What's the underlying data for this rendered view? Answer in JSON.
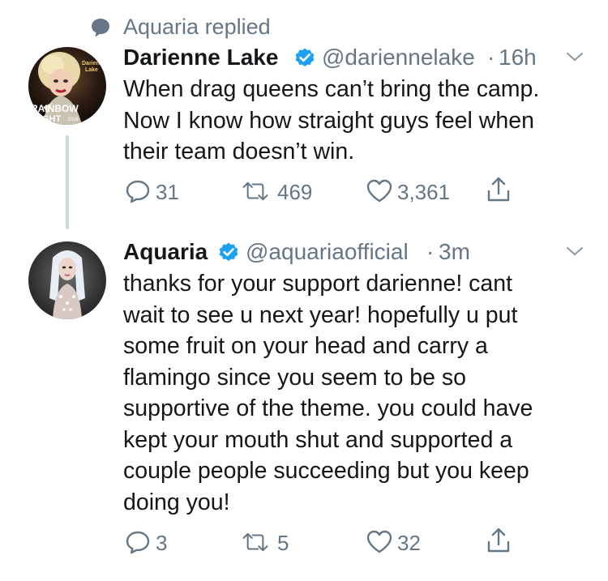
{
  "context": {
    "replied_text": "Aquaria replied",
    "icon": "speech-bubble-icon"
  },
  "tweets": [
    {
      "name": "Darienne Lake",
      "handle": "@dariennelake",
      "separator": "·",
      "time": "16h",
      "avatar": {
        "text_top": "Darienne\nLake",
        "banner_line1": "RAINBOW",
        "banner_line2": "NIGHT",
        "banner_year": "2018"
      },
      "text_lines": [
        "When drag queens can’t bring the camp.",
        "Now I know how straight guys feel when",
        "their team doesn’t win."
      ],
      "actions": {
        "replies": "31",
        "retweets": "469",
        "likes": "3,361"
      }
    },
    {
      "name": "Aquaria",
      "handle": "@aquariaofficial",
      "separator": "·",
      "time": "3m",
      "text_lines": [
        "thanks for your support darienne! cant",
        "wait to see u next year! hopefully u put",
        "some fruit on your head and carry a",
        "flamingo since you seem to be so",
        "supportive of the theme. you could have",
        "kept your mouth shut and supported a",
        "couple people succeeding but you keep",
        "doing you!"
      ],
      "actions": {
        "replies": "3",
        "retweets": "5",
        "likes": "32"
      }
    }
  ],
  "colors": {
    "text": "#14171a",
    "secondary": "#657786",
    "verified": "#1da1f2",
    "thread_line": "#ccd6dd"
  }
}
